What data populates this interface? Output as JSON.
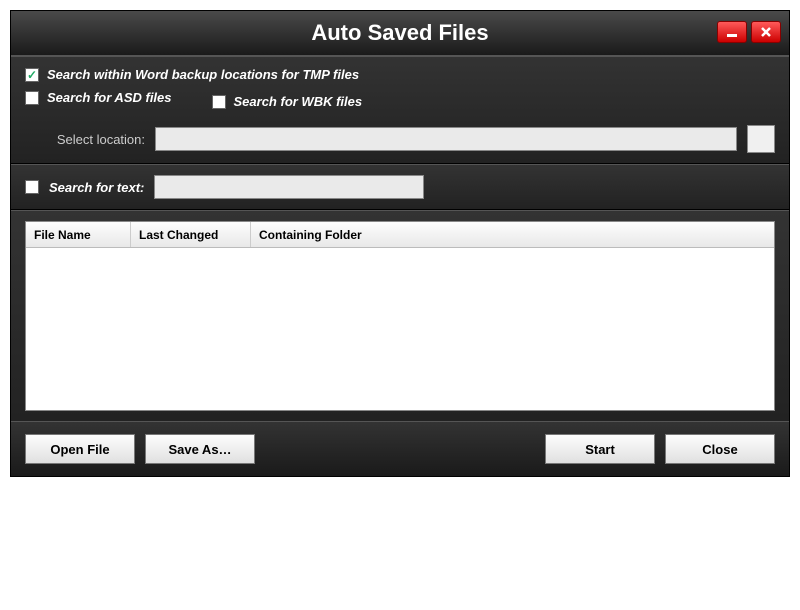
{
  "title": "Auto Saved Files",
  "options": {
    "tmp_label": "Search within Word backup locations for TMP files",
    "tmp_checked": true,
    "asd_label": "Search for ASD files",
    "asd_checked": false,
    "wbk_label": "Search for WBK files",
    "wbk_checked": false,
    "location_label": "Select location:",
    "location_value": ""
  },
  "search_text": {
    "label": "Search for text:",
    "checked": false,
    "value": ""
  },
  "table": {
    "columns": [
      "File Name",
      "Last Changed",
      "Containing Folder"
    ],
    "rows": []
  },
  "buttons": {
    "open_file": "Open File",
    "save_as": "Save As…",
    "start": "Start",
    "close": "Close"
  }
}
